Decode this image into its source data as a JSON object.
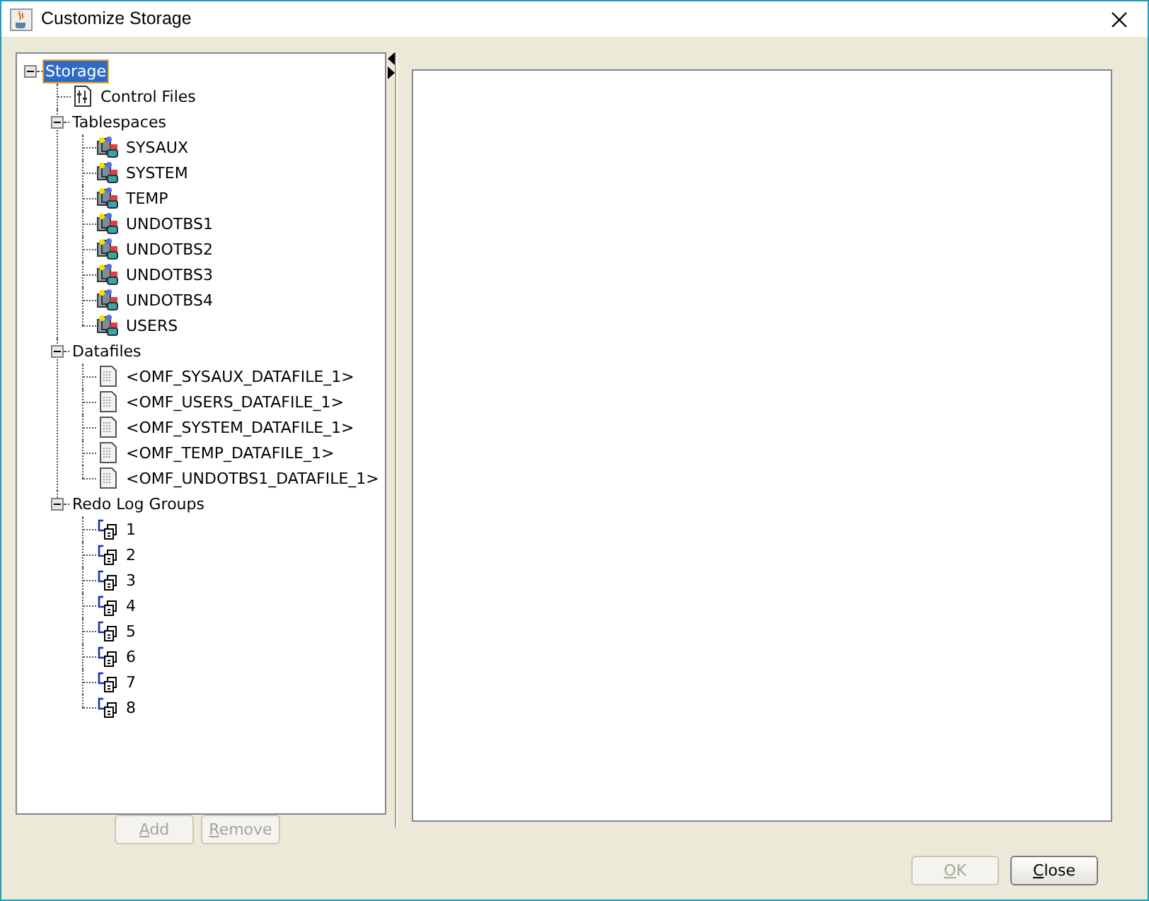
{
  "window": {
    "title": "Customize Storage"
  },
  "tree": [
    {
      "label": "Storage",
      "selected": true,
      "expanded": true,
      "children": [
        {
          "label": "Control Files",
          "kind": "controlfile",
          "selected": false
        },
        {
          "label": "Tablespaces",
          "selected": false,
          "expanded": true,
          "children": [
            {
              "label": "SYSAUX",
              "kind": "tablespace",
              "selected": false
            },
            {
              "label": "SYSTEM",
              "kind": "tablespace",
              "selected": false
            },
            {
              "label": "TEMP",
              "kind": "tablespace",
              "selected": false
            },
            {
              "label": "UNDOTBS1",
              "kind": "tablespace",
              "selected": false
            },
            {
              "label": "UNDOTBS2",
              "kind": "tablespace",
              "selected": false
            },
            {
              "label": "UNDOTBS3",
              "kind": "tablespace",
              "selected": false
            },
            {
              "label": "UNDOTBS4",
              "kind": "tablespace",
              "selected": false
            },
            {
              "label": "USERS",
              "kind": "tablespace",
              "selected": false
            }
          ]
        },
        {
          "label": "Datafiles",
          "selected": false,
          "expanded": true,
          "children": [
            {
              "label": "<OMF_SYSAUX_DATAFILE_1>",
              "kind": "datafile",
              "selected": false
            },
            {
              "label": "<OMF_USERS_DATAFILE_1>",
              "kind": "datafile",
              "selected": false
            },
            {
              "label": "<OMF_SYSTEM_DATAFILE_1>",
              "kind": "datafile",
              "selected": false
            },
            {
              "label": "<OMF_TEMP_DATAFILE_1>",
              "kind": "datafile",
              "selected": false
            },
            {
              "label": "<OMF_UNDOTBS1_DATAFILE_1>",
              "kind": "datafile",
              "selected": false
            }
          ]
        },
        {
          "label": "Redo Log Groups",
          "selected": false,
          "expanded": true,
          "children": [
            {
              "label": "1",
              "kind": "redolog",
              "selected": false
            },
            {
              "label": "2",
              "kind": "redolog",
              "selected": false
            },
            {
              "label": "3",
              "kind": "redolog",
              "selected": false
            },
            {
              "label": "4",
              "kind": "redolog",
              "selected": false
            },
            {
              "label": "5",
              "kind": "redolog",
              "selected": false
            },
            {
              "label": "6",
              "kind": "redolog",
              "selected": false
            },
            {
              "label": "7",
              "kind": "redolog",
              "selected": false
            },
            {
              "label": "8",
              "kind": "redolog",
              "selected": false
            }
          ]
        }
      ]
    }
  ],
  "tree_buttons": [
    {
      "label": "Add",
      "disabled": true,
      "underline_first": true
    },
    {
      "label": "Remove",
      "disabled": true,
      "underline_first": true
    }
  ],
  "dialog_buttons": [
    {
      "label": "OK",
      "disabled": true,
      "underline_first": true
    },
    {
      "label": "Close",
      "disabled": false,
      "underline_first": true
    }
  ]
}
